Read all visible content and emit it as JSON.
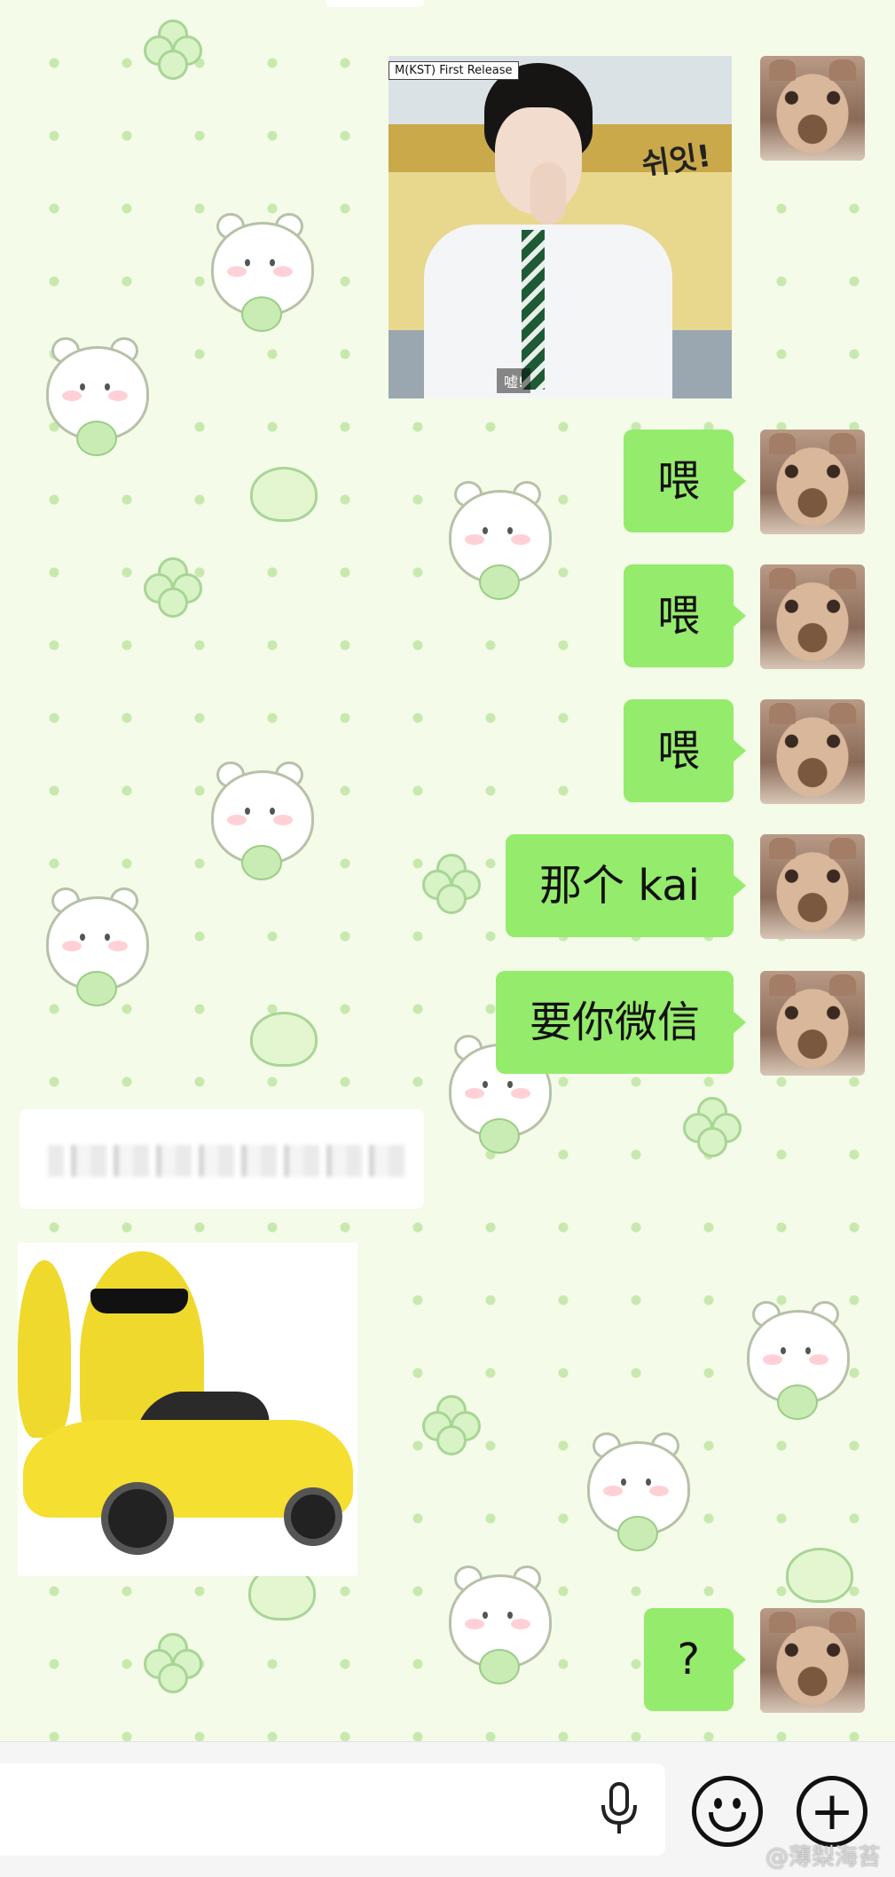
{
  "messages": [
    {
      "type": "image",
      "from": "me",
      "caption": "M(KST) First Release",
      "overlay_text": "쉬잇!",
      "subtitle": "嘘!"
    },
    {
      "type": "text",
      "from": "me",
      "text": "喂"
    },
    {
      "type": "text",
      "from": "me",
      "text": "喂"
    },
    {
      "type": "text",
      "from": "me",
      "text": "喂"
    },
    {
      "type": "text",
      "from": "me",
      "text": "那个 kai"
    },
    {
      "type": "text",
      "from": "me",
      "text": "要你微信"
    },
    {
      "type": "text",
      "from": "other",
      "text": "",
      "redacted": true
    },
    {
      "type": "image",
      "from": "other",
      "description": "sticker"
    },
    {
      "type": "text",
      "from": "me",
      "text": "?"
    }
  ],
  "input_bar": {
    "icons": [
      "mic-icon",
      "emoji-icon",
      "plus-icon"
    ],
    "plus_glyph": "+"
  },
  "watermark": "@薄梨海苔",
  "colors": {
    "bubble_me": "#95eb6c",
    "bubble_other": "#ffffff",
    "wallpaper": "#f4fbe8"
  }
}
